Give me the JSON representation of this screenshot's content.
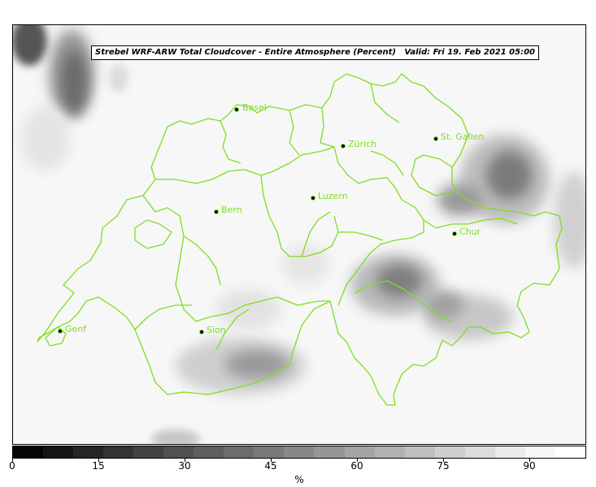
{
  "title": {
    "main": "Strebel WRF-ARW Total Cloudcover - Entire Atmosphere (Percent)",
    "valid": "Valid: Fri 19. Feb 2021 05:00"
  },
  "cities": [
    {
      "name": "Basel"
    },
    {
      "name": "Zürich"
    },
    {
      "name": "St. Gallen"
    },
    {
      "name": "Luzern"
    },
    {
      "name": "Bern"
    },
    {
      "name": "Chur"
    },
    {
      "name": "Genf"
    },
    {
      "name": "Sion"
    }
  ],
  "colorbar": {
    "ticks": [
      "0",
      "15",
      "30",
      "45",
      "60",
      "75",
      "90"
    ],
    "unit": "%",
    "colors": [
      "#050505",
      "#151515",
      "#252525",
      "#333333",
      "#424242",
      "#505050",
      "#5e5e5e",
      "#6c6c6c",
      "#7a7a7a",
      "#888888",
      "#969696",
      "#a4a4a4",
      "#b2b2b2",
      "#c0c0c0",
      "#cecece",
      "#dcdcdc",
      "#eaeaea",
      "#f7f7f7",
      "#ffffff"
    ]
  },
  "colors": {
    "border": "#7ddf20",
    "label": "#7ddf20",
    "background": "#f7f7f7"
  }
}
